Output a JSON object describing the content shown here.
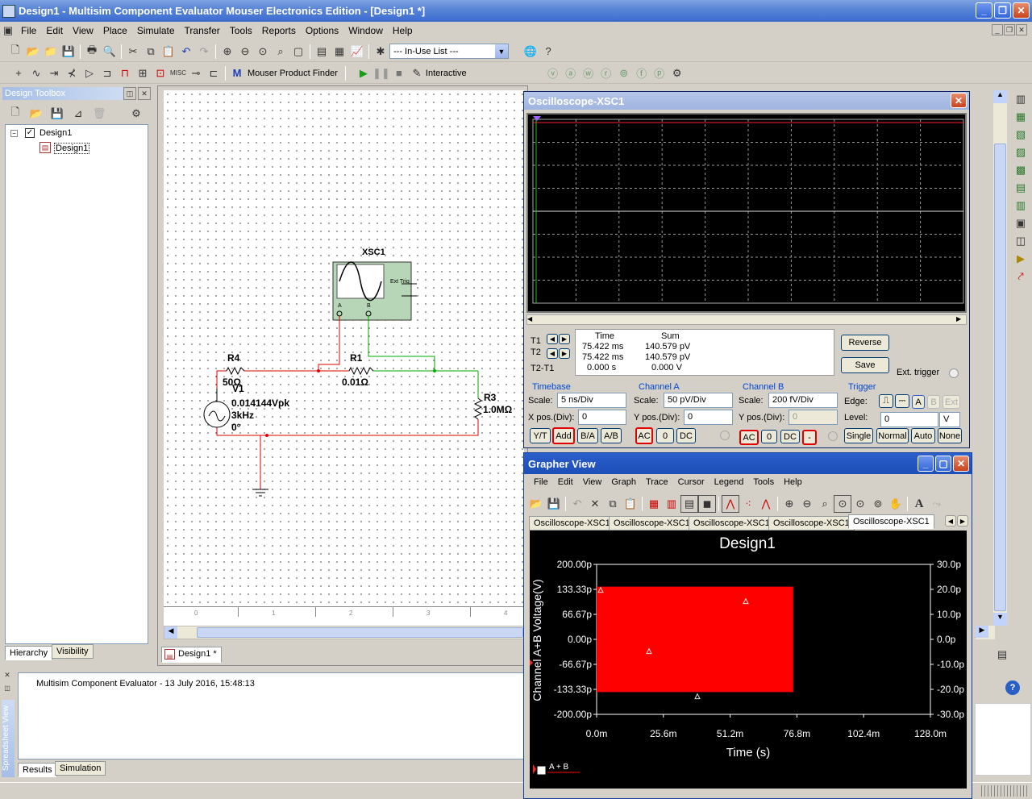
{
  "window": {
    "title": "Design1 - Multisim Component Evaluator Mouser Electronics Edition - [Design1 *]"
  },
  "menu": [
    {
      "label": "File",
      "u": "F"
    },
    {
      "label": "Edit",
      "u": "E"
    },
    {
      "label": "View",
      "u": "V"
    },
    {
      "label": "Place",
      "u": "P"
    },
    {
      "label": "Simulate",
      "u": "S"
    },
    {
      "label": "Transfer",
      "u": "n"
    },
    {
      "label": "Tools",
      "u": "T"
    },
    {
      "label": "Reports",
      "u": "R"
    },
    {
      "label": "Options",
      "u": "O"
    },
    {
      "label": "Window",
      "u": "W"
    },
    {
      "label": "Help",
      "u": "H"
    }
  ],
  "toolbar": {
    "in_use_list": "--- In-Use List ---",
    "mouser_label": "Mouser Product Finder",
    "interactive_label": "Interactive"
  },
  "design_toolbox": {
    "title": "Design Toolbox",
    "root": "Design1",
    "child": "Design1",
    "tab_hierarchy": "Hierarchy",
    "tab_visibility": "Visibility"
  },
  "workspace": {
    "tab": "Design1 *",
    "ruler": [
      "0",
      "1",
      "2",
      "3",
      "4"
    ]
  },
  "circuit": {
    "scope_label": "XSC1",
    "ext_trig": "Ext Trig",
    "ch_a": "A",
    "ch_b": "B",
    "r4_name": "R4",
    "r4_value": "50Ω",
    "r1_name": "R1",
    "r1_value": "0.01Ω",
    "r3_name": "R3",
    "r3_value": "1.0MΩ",
    "v1_name": "V1",
    "v1_amp": "0.014144Vpk",
    "v1_freq": "3kHz",
    "v1_phase": "0°"
  },
  "spreadsheet": {
    "message": "Multisim Component Evaluator  -  13 July 2016, 15:48:13",
    "tab_results": "Results",
    "tab_simulation": "Simulation",
    "side_label": "Spreadsheet View"
  },
  "oscilloscope": {
    "title": "Oscilloscope-XSC1",
    "readout": {
      "col_time": "Time",
      "col_sum": "Sum",
      "t1": "T1",
      "t2": "T2",
      "t2t1": "T2-T1",
      "t1_time": "75.422 ms",
      "t1_sum": "140.579 pV",
      "t2_time": "75.422 ms",
      "t2_sum": "140.579 pV",
      "d_time": "0.000 s",
      "d_sum": "0.000 V"
    },
    "reverse": "Reverse",
    "save": "Save",
    "ext_trigger": "Ext. trigger",
    "timebase": {
      "title": "Timebase",
      "scale_label": "Scale:",
      "scale": "5 ns/Div",
      "xpos_label": "X pos.(Div):",
      "xpos": "0",
      "yt": "Y/T",
      "add": "Add",
      "ba": "B/A",
      "ab": "A/B"
    },
    "channel_a": {
      "title": "Channel A",
      "scale_label": "Scale:",
      "scale": "50 pV/Div",
      "ypos_label": "Y pos.(Div):",
      "ypos": "0",
      "ac": "AC",
      "zero": "0",
      "dc": "DC"
    },
    "channel_b": {
      "title": "Channel B",
      "scale_label": "Scale:",
      "scale": "200 fV/Div",
      "ypos_label": "Y pos.(Div):",
      "ypos": "0",
      "ac": "AC",
      "zero": "0",
      "dc": "DC",
      "minus": "-"
    },
    "trigger": {
      "title": "Trigger",
      "edge_label": "Edge:",
      "level_label": "Level:",
      "level": "0",
      "level_unit": "V",
      "a": "A",
      "b": "B",
      "ext": "Ext",
      "single": "Single",
      "normal": "Normal",
      "auto": "Auto",
      "none": "None"
    }
  },
  "grapher": {
    "title": "Grapher View",
    "menu": [
      "File",
      "Edit",
      "View",
      "Graph",
      "Trace",
      "Cursor",
      "Legend",
      "Tools",
      "Help"
    ],
    "tabs": [
      "Oscilloscope-XSC1",
      "Oscilloscope-XSC1",
      "Oscilloscope-XSC1",
      "Oscilloscope-XSC1",
      "Oscilloscope-XSC1"
    ]
  },
  "chart_data": {
    "type": "area",
    "title": "Design1",
    "xlabel": "Time (s)",
    "ylabel": "Channel A+B Voltage(V)",
    "x_ticks": [
      "0.0m",
      "25.6m",
      "51.2m",
      "76.8m",
      "102.4m",
      "128.0m"
    ],
    "y_ticks": [
      "200.00p",
      "133.33p",
      "66.67p",
      "0.00p",
      "-66.67p",
      "-133.33p",
      "-200.00p"
    ],
    "y2_ticks": [
      "30.0p",
      "20.0p",
      "10.0p",
      "0.0p",
      "-10.0p",
      "-20.0p",
      "-30.0p"
    ],
    "xlim": [
      0,
      128.0
    ],
    "ylim": [
      -200,
      200
    ],
    "series": [
      {
        "name": "A + B",
        "color": "#ff0000",
        "x": [
          0.0,
          75.4
        ],
        "y_min": -140.6,
        "y_max": 140.6
      }
    ],
    "legend": "bottom-left"
  }
}
